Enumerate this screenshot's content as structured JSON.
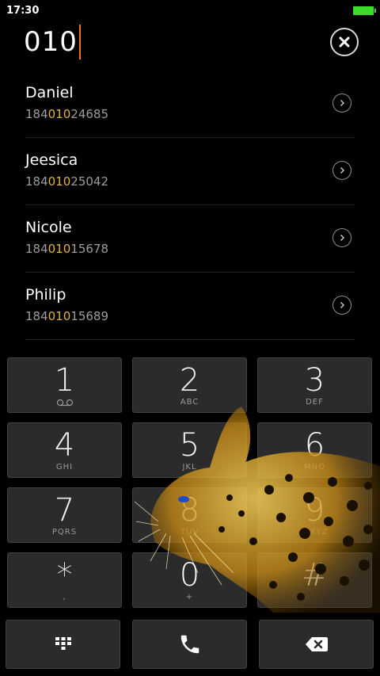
{
  "status_bar": {
    "time": "17:30"
  },
  "dialer": {
    "input_value": "010"
  },
  "contacts": [
    {
      "name": "Daniel",
      "number_prefix": "184",
      "number_match": "010",
      "number_suffix": "24685"
    },
    {
      "name": "Jeesica",
      "number_prefix": "184",
      "number_match": "010",
      "number_suffix": "25042"
    },
    {
      "name": "Nicole",
      "number_prefix": "184",
      "number_match": "010",
      "number_suffix": "15678"
    },
    {
      "name": "Philip",
      "number_prefix": "184",
      "number_match": "010",
      "number_suffix": "15689"
    }
  ],
  "keypad": [
    {
      "digit": "1",
      "letters": "",
      "sub_icon": "voicemail-icon"
    },
    {
      "digit": "2",
      "letters": "ABC"
    },
    {
      "digit": "3",
      "letters": "DEF"
    },
    {
      "digit": "4",
      "letters": "GHI"
    },
    {
      "digit": "5",
      "letters": "JKL"
    },
    {
      "digit": "6",
      "letters": "MNO"
    },
    {
      "digit": "7",
      "letters": "PQRS"
    },
    {
      "digit": "8",
      "letters": "TUV"
    },
    {
      "digit": "9",
      "letters": "WXYZ"
    },
    {
      "digit": "*",
      "letters": ","
    },
    {
      "digit": "0",
      "letters": "+"
    },
    {
      "digit": "#",
      "letters": ""
    }
  ],
  "bottom_bar": {
    "left_icon": "keypad-grid-icon",
    "center_icon": "phone-icon",
    "right_icon": "backspace-icon"
  },
  "colors": {
    "accent": "#e3b43d",
    "cursor": "#e9782c",
    "battery": "#3ddc2b",
    "key_bg": "#2b2b2b",
    "background": "#000000"
  }
}
